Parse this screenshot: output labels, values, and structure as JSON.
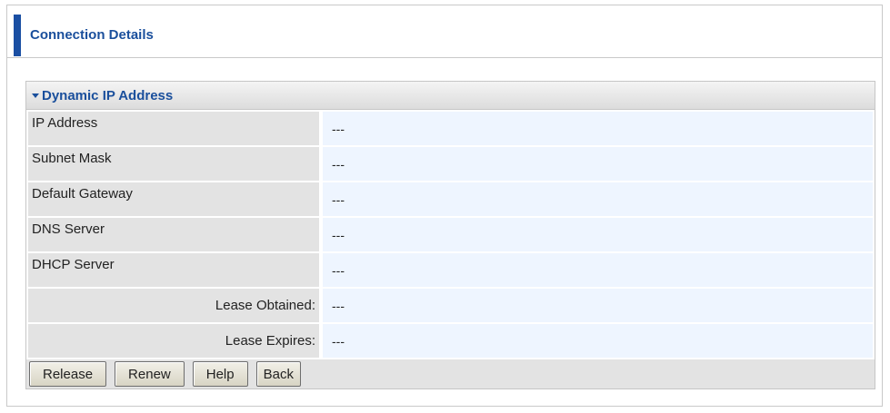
{
  "page": {
    "title": "Connection Details"
  },
  "section": {
    "title": "Dynamic IP Address",
    "rows": [
      {
        "label": "IP Address",
        "value": "---"
      },
      {
        "label": "Subnet Mask",
        "value": "---"
      },
      {
        "label": "Default Gateway",
        "value": "---"
      },
      {
        "label": "DNS Server",
        "value": "---"
      },
      {
        "label": "DHCP Server",
        "value": "---"
      },
      {
        "label": "Lease Obtained:",
        "value": "---"
      },
      {
        "label": "Lease Expires:",
        "value": "---"
      }
    ]
  },
  "buttons": {
    "release": "Release",
    "renew": "Renew",
    "help": "Help",
    "back": "Back"
  },
  "colors": {
    "accent": "#1a4fa3",
    "label_bg": "#e3e3e3",
    "value_bg": "#eef5ff"
  }
}
